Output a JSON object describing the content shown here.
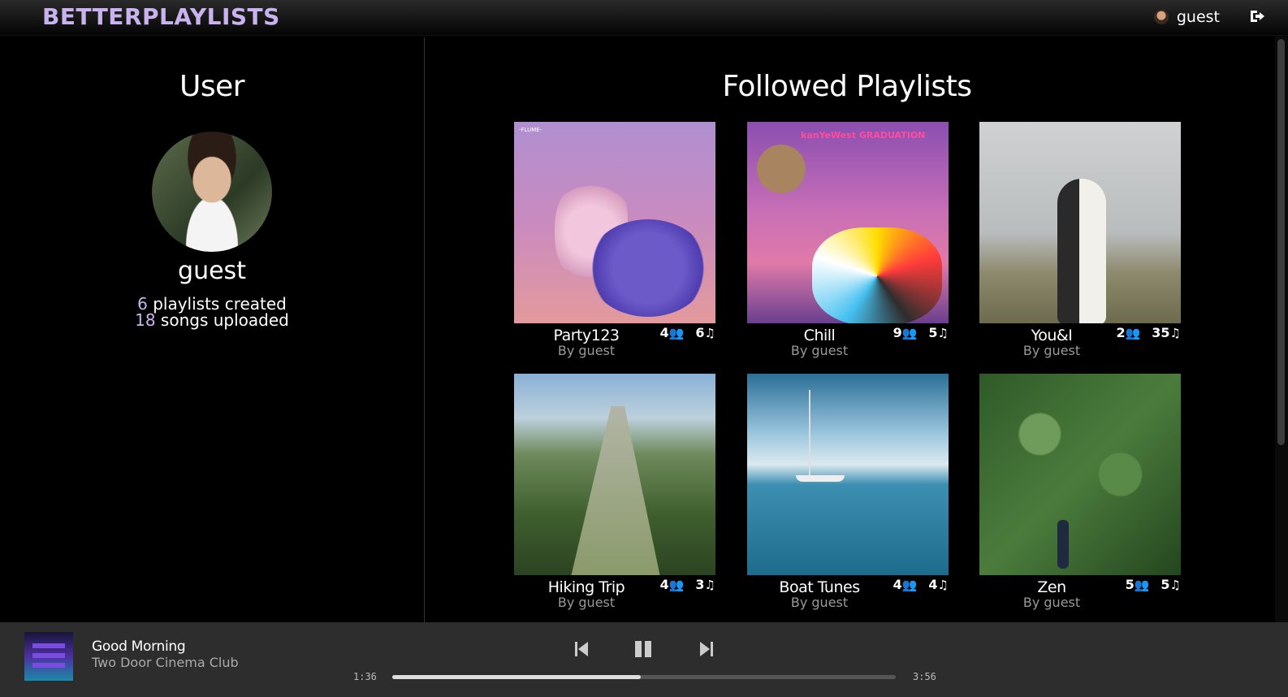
{
  "header": {
    "logo": "BETTERPLAYLISTS",
    "username": "guest",
    "logout_icon": "logout-icon"
  },
  "user_panel": {
    "title": "User",
    "username": "guest",
    "playlists_count": "6",
    "playlists_label": " playlists created",
    "songs_count": "18",
    "songs_label": " songs uploaded"
  },
  "followed": {
    "title": "Followed Playlists",
    "playlists": [
      {
        "name": "Party123",
        "by": "By guest",
        "followers": "4",
        "songs": "6"
      },
      {
        "name": "Chill",
        "by": "By guest",
        "followers": "9",
        "songs": "5"
      },
      {
        "name": "You&I",
        "by": "By guest",
        "followers": "2",
        "songs": "35"
      },
      {
        "name": "Hiking Trip",
        "by": "By guest",
        "followers": "4",
        "songs": "3"
      },
      {
        "name": "Boat Tunes",
        "by": "By guest",
        "followers": "4",
        "songs": "4"
      },
      {
        "name": "Zen",
        "by": "By guest",
        "followers": "5",
        "songs": "5"
      }
    ]
  },
  "cover_art_text": {
    "party": "-FLUME-",
    "chill": "kanYeWest GRADUATION"
  },
  "player": {
    "song_title": "Good Morning",
    "artist": "Two Door Cinema Club",
    "elapsed": "1:36",
    "duration": "3:56",
    "progress": 0.493
  },
  "colors": {
    "accent": "#c9b3ef",
    "background": "#000000",
    "player_bg": "#2d2d2d"
  }
}
